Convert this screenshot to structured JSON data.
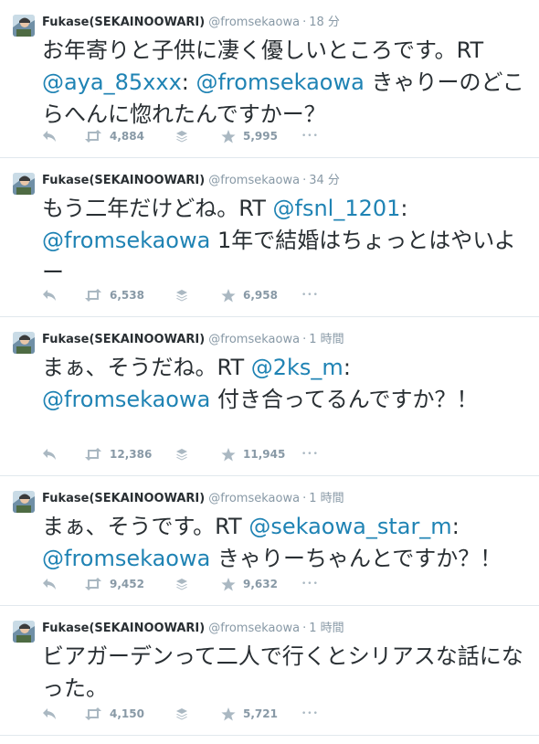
{
  "tweets": [
    {
      "name": "Fukase(SEKAINOOWARI)",
      "handle": "@fromsekaowa",
      "dot": "·",
      "time": "18 分",
      "segments": [
        {
          "text": "お年寄りと子供に凄く優しいところです。RT ",
          "mention": false
        },
        {
          "text": "@aya_85xxx",
          "mention": true
        },
        {
          "text": ": ",
          "mention": false
        },
        {
          "text": "@fromsekaowa",
          "mention": true
        },
        {
          "text": " きゃりーのどこらへんに惚れたんですかー？",
          "mention": false
        }
      ],
      "retweets": "4,884",
      "favorites": "5,995"
    },
    {
      "name": "Fukase(SEKAINOOWARI)",
      "handle": "@fromsekaowa",
      "dot": "·",
      "time": "34 分",
      "segments": [
        {
          "text": "もう二年だけどね。RT ",
          "mention": false
        },
        {
          "text": "@fsnl_1201",
          "mention": true
        },
        {
          "text": ": ",
          "mention": false
        },
        {
          "text": "@fromsekaowa",
          "mention": true
        },
        {
          "text": " 1年で結婚はちょっとはやいよー",
          "mention": false
        }
      ],
      "retweets": "6,538",
      "favorites": "6,958"
    },
    {
      "name": "Fukase(SEKAINOOWARI)",
      "handle": "@fromsekaowa",
      "dot": "·",
      "time": "1 時間",
      "segments": [
        {
          "text": "まぁ、そうだね。RT ",
          "mention": false
        },
        {
          "text": "@2ks_m",
          "mention": true
        },
        {
          "text": ": ",
          "mention": false
        },
        {
          "text": "@fromsekaowa",
          "mention": true
        },
        {
          "text": " 付き合ってるんですか？！",
          "mention": false
        }
      ],
      "retweets": "12,386",
      "favorites": "11,945"
    },
    {
      "name": "Fukase(SEKAINOOWARI)",
      "handle": "@fromsekaowa",
      "dot": "·",
      "time": "1 時間",
      "segments": [
        {
          "text": "まぁ、そうです。RT ",
          "mention": false
        },
        {
          "text": "@sekaowa_star_m",
          "mention": true
        },
        {
          "text": ": ",
          "mention": false
        },
        {
          "text": "@fromsekaowa",
          "mention": true
        },
        {
          "text": " きゃりーちゃんとですか？！",
          "mention": false
        }
      ],
      "retweets": "9,452",
      "favorites": "9,632"
    },
    {
      "name": "Fukase(SEKAINOOWARI)",
      "handle": "@fromsekaowa",
      "dot": "·",
      "time": "1 時間",
      "segments": [
        {
          "text": "ビアガーデンって二人で行くとシリアスな話になった。",
          "mention": false
        }
      ],
      "retweets": "4,150",
      "favorites": "5,721"
    }
  ],
  "more_glyph": "•••",
  "colors": {
    "mention": "#1f83b4",
    "text": "#292f33",
    "meta": "#8899a6",
    "icon": "#aab8c2",
    "divider": "#e1e8ed"
  }
}
